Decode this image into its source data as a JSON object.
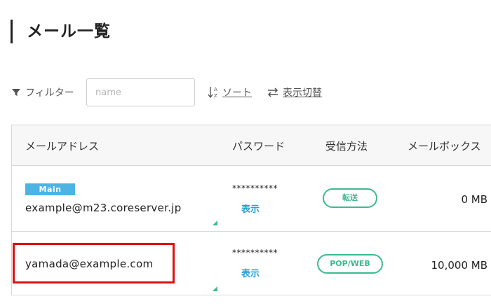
{
  "page": {
    "title": "メール一覧"
  },
  "filter": {
    "label": "フィルター",
    "placeholder": "name",
    "sort_label": "ソート",
    "toggle_label": "表示切替",
    "icons": [
      "filter-icon",
      "sort-az-icon",
      "swap-arrows-icon"
    ]
  },
  "table": {
    "headers": [
      "メールアドレス",
      "パスワード",
      "受信方法",
      "メールボックス"
    ],
    "rows": [
      {
        "badge": "Main",
        "email": "example@m23.coreserver.jp",
        "password": "**********",
        "show_label": "表示",
        "method": "転送",
        "size": "0 MB"
      },
      {
        "badge": "",
        "email": "yamada@example.com",
        "password": "**********",
        "show_label": "表示",
        "method": "POP/WEB",
        "size": "10,000 MB"
      }
    ]
  },
  "colors": {
    "accent_green": "#3cba92",
    "badge_blue": "#4db3e3",
    "link_blue": "#2a9fd6",
    "highlight_red": "#e01010"
  }
}
